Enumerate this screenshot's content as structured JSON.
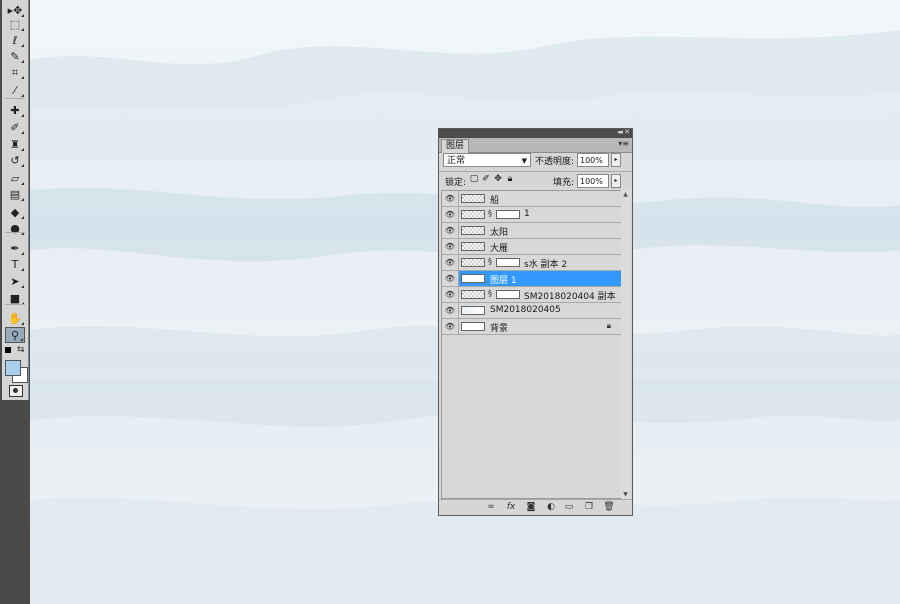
{
  "colors": {
    "toolbar_bg": "#4a4a4a",
    "panel_bg": "#d6d6d6",
    "selected_row": "#3399ff",
    "foreground_swatch": "#aacfee",
    "background_swatch": "#ffffff"
  },
  "toolbar": {
    "tools": [
      {
        "icon": "move-tool-icon",
        "glyph": "▸✥"
      },
      {
        "icon": "marquee-tool-icon",
        "glyph": "⬚"
      },
      {
        "icon": "lasso-tool-icon",
        "glyph": "ℓ"
      },
      {
        "icon": "quick-select-tool-icon",
        "glyph": "✎"
      },
      {
        "icon": "crop-tool-icon",
        "glyph": "⌗"
      },
      {
        "icon": "eyedropper-tool-icon",
        "glyph": "⁄"
      },
      {
        "icon": "healing-brush-tool-icon",
        "glyph": "✚"
      },
      {
        "icon": "brush-tool-icon",
        "glyph": "✐"
      },
      {
        "icon": "clone-stamp-tool-icon",
        "glyph": "♜"
      },
      {
        "icon": "history-brush-tool-icon",
        "glyph": "↺"
      },
      {
        "icon": "eraser-tool-icon",
        "glyph": "▱"
      },
      {
        "icon": "gradient-tool-icon",
        "glyph": "▤"
      },
      {
        "icon": "blur-tool-icon",
        "glyph": "◆"
      },
      {
        "icon": "dodge-tool-icon",
        "glyph": "●"
      },
      {
        "icon": "pen-tool-icon",
        "glyph": "✒"
      },
      {
        "icon": "type-tool-icon",
        "glyph": "T"
      },
      {
        "icon": "path-select-tool-icon",
        "glyph": "➤"
      },
      {
        "icon": "shape-tool-icon",
        "glyph": "■"
      },
      {
        "icon": "hand-tool-icon",
        "glyph": "✋"
      },
      {
        "icon": "zoom-tool-icon",
        "glyph": "⚲"
      }
    ]
  },
  "layers_panel": {
    "tab_label": "图层",
    "blend_mode": "正常",
    "opacity_label": "不透明度:",
    "opacity_value": "100%",
    "lock_label": "锁定:",
    "fill_label": "填充:",
    "fill_value": "100%",
    "layers": [
      {
        "name": "船",
        "thumb": "transparent",
        "has_mask": false,
        "selected": false,
        "locked": false
      },
      {
        "name": "1",
        "thumb": "transparent",
        "has_mask": true,
        "selected": false,
        "locked": false
      },
      {
        "name": "太阳",
        "thumb": "transparent",
        "has_mask": false,
        "selected": false,
        "locked": false
      },
      {
        "name": "大雁",
        "thumb": "transparent",
        "has_mask": false,
        "selected": false,
        "locked": false
      },
      {
        "name": "s水 副本 2",
        "thumb": "transparent",
        "has_mask": true,
        "selected": false,
        "locked": false
      },
      {
        "name": "图层 1",
        "thumb": "solid",
        "has_mask": false,
        "selected": true,
        "locked": false
      },
      {
        "name": "SM2018020404 副本",
        "thumb": "transparent",
        "has_mask": true,
        "selected": false,
        "locked": false
      },
      {
        "name": "SM2018020405",
        "thumb": "image",
        "has_mask": false,
        "selected": false,
        "locked": false
      },
      {
        "name": "背景",
        "thumb": "solid",
        "has_mask": false,
        "selected": false,
        "locked": true
      }
    ],
    "footer_icons": [
      "link-layers-icon",
      "fx-icon",
      "add-mask-icon",
      "adjustment-layer-icon",
      "new-group-icon",
      "new-layer-icon",
      "delete-layer-icon"
    ]
  }
}
